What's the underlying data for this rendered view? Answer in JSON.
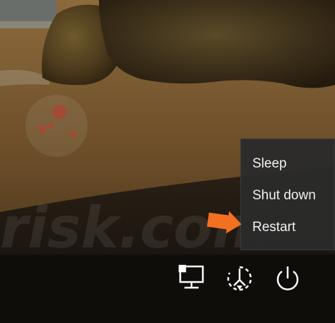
{
  "power_menu": {
    "items": [
      {
        "label": "Sleep"
      },
      {
        "label": "Shut down"
      },
      {
        "label": "Restart"
      }
    ]
  },
  "tray": {
    "network_icon": "network-icon",
    "accessibility_icon": "ease-of-access-icon",
    "power_icon": "power-icon"
  },
  "colors": {
    "menu_bg": "#2b2b2b",
    "menu_text": "#f2f2f2",
    "arrow": "#f37021"
  }
}
